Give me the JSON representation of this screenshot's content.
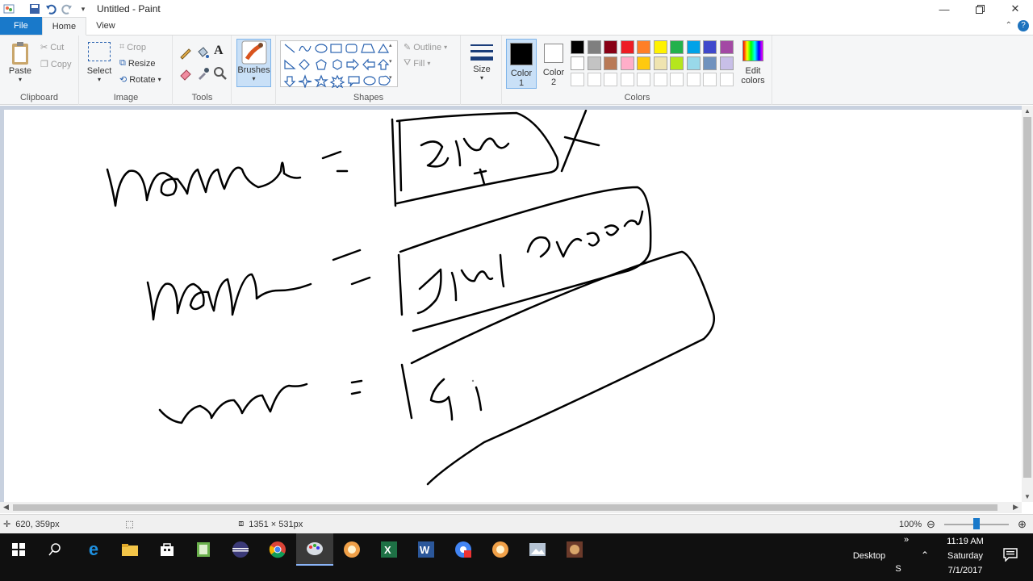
{
  "window": {
    "title": "Untitled - Paint",
    "minimize_icon": "minimize-icon",
    "restore_icon": "restore-icon",
    "close_icon": "close-icon"
  },
  "tabs": [
    {
      "label": "File"
    },
    {
      "label": "Home"
    },
    {
      "label": "View"
    }
  ],
  "ribbon": {
    "clipboard": {
      "label": "Clipboard",
      "paste": "Paste",
      "cut": "Cut",
      "copy": "Copy"
    },
    "image": {
      "label": "Image",
      "select": "Select",
      "crop": "Crop",
      "resize": "Resize",
      "rotate": "Rotate"
    },
    "tools": {
      "label": "Tools"
    },
    "brushes": {
      "label": "Brushes"
    },
    "shapes": {
      "label": "Shapes",
      "outline": "Outline",
      "fill": "Fill"
    },
    "size": {
      "label": "Size"
    },
    "colors": {
      "label": "Colors",
      "color1_label": "Color\n1",
      "color1_a": "Color",
      "color1_b": "1",
      "color2_a": "Color",
      "color2_b": "2",
      "edit_a": "Edit",
      "edit_b": "colors",
      "color1": "#000000",
      "color2": "#ffffff",
      "palette_row1": [
        "#000000",
        "#7f7f7f",
        "#880015",
        "#ed1c24",
        "#ff7f27",
        "#fff200",
        "#22b14c",
        "#00a2e8",
        "#3f48cc",
        "#a349a4"
      ],
      "palette_row2": [
        "#ffffff",
        "#c3c3c3",
        "#b97a57",
        "#ffaec9",
        "#ffc90e",
        "#efe4b0",
        "#b5e61d",
        "#99d9ea",
        "#7092be",
        "#c8bfe7"
      ],
      "palette_row3": [
        "#ffffff",
        "#ffffff",
        "#ffffff",
        "#ffffff",
        "#ffffff",
        "#ffffff",
        "#ffffff",
        "#ffffff",
        "#ffffff",
        "#ffffff"
      ]
    }
  },
  "status": {
    "cursor_pos": "620, 359px",
    "canvas_size": "1351 × 531px",
    "zoom": "100%"
  },
  "taskbar": {
    "desktop_label": "Desktop",
    "time": "11:19 AM",
    "day": "Saturday",
    "date": "7/1/2017",
    "s_label": "S",
    "overflow": "»"
  }
}
